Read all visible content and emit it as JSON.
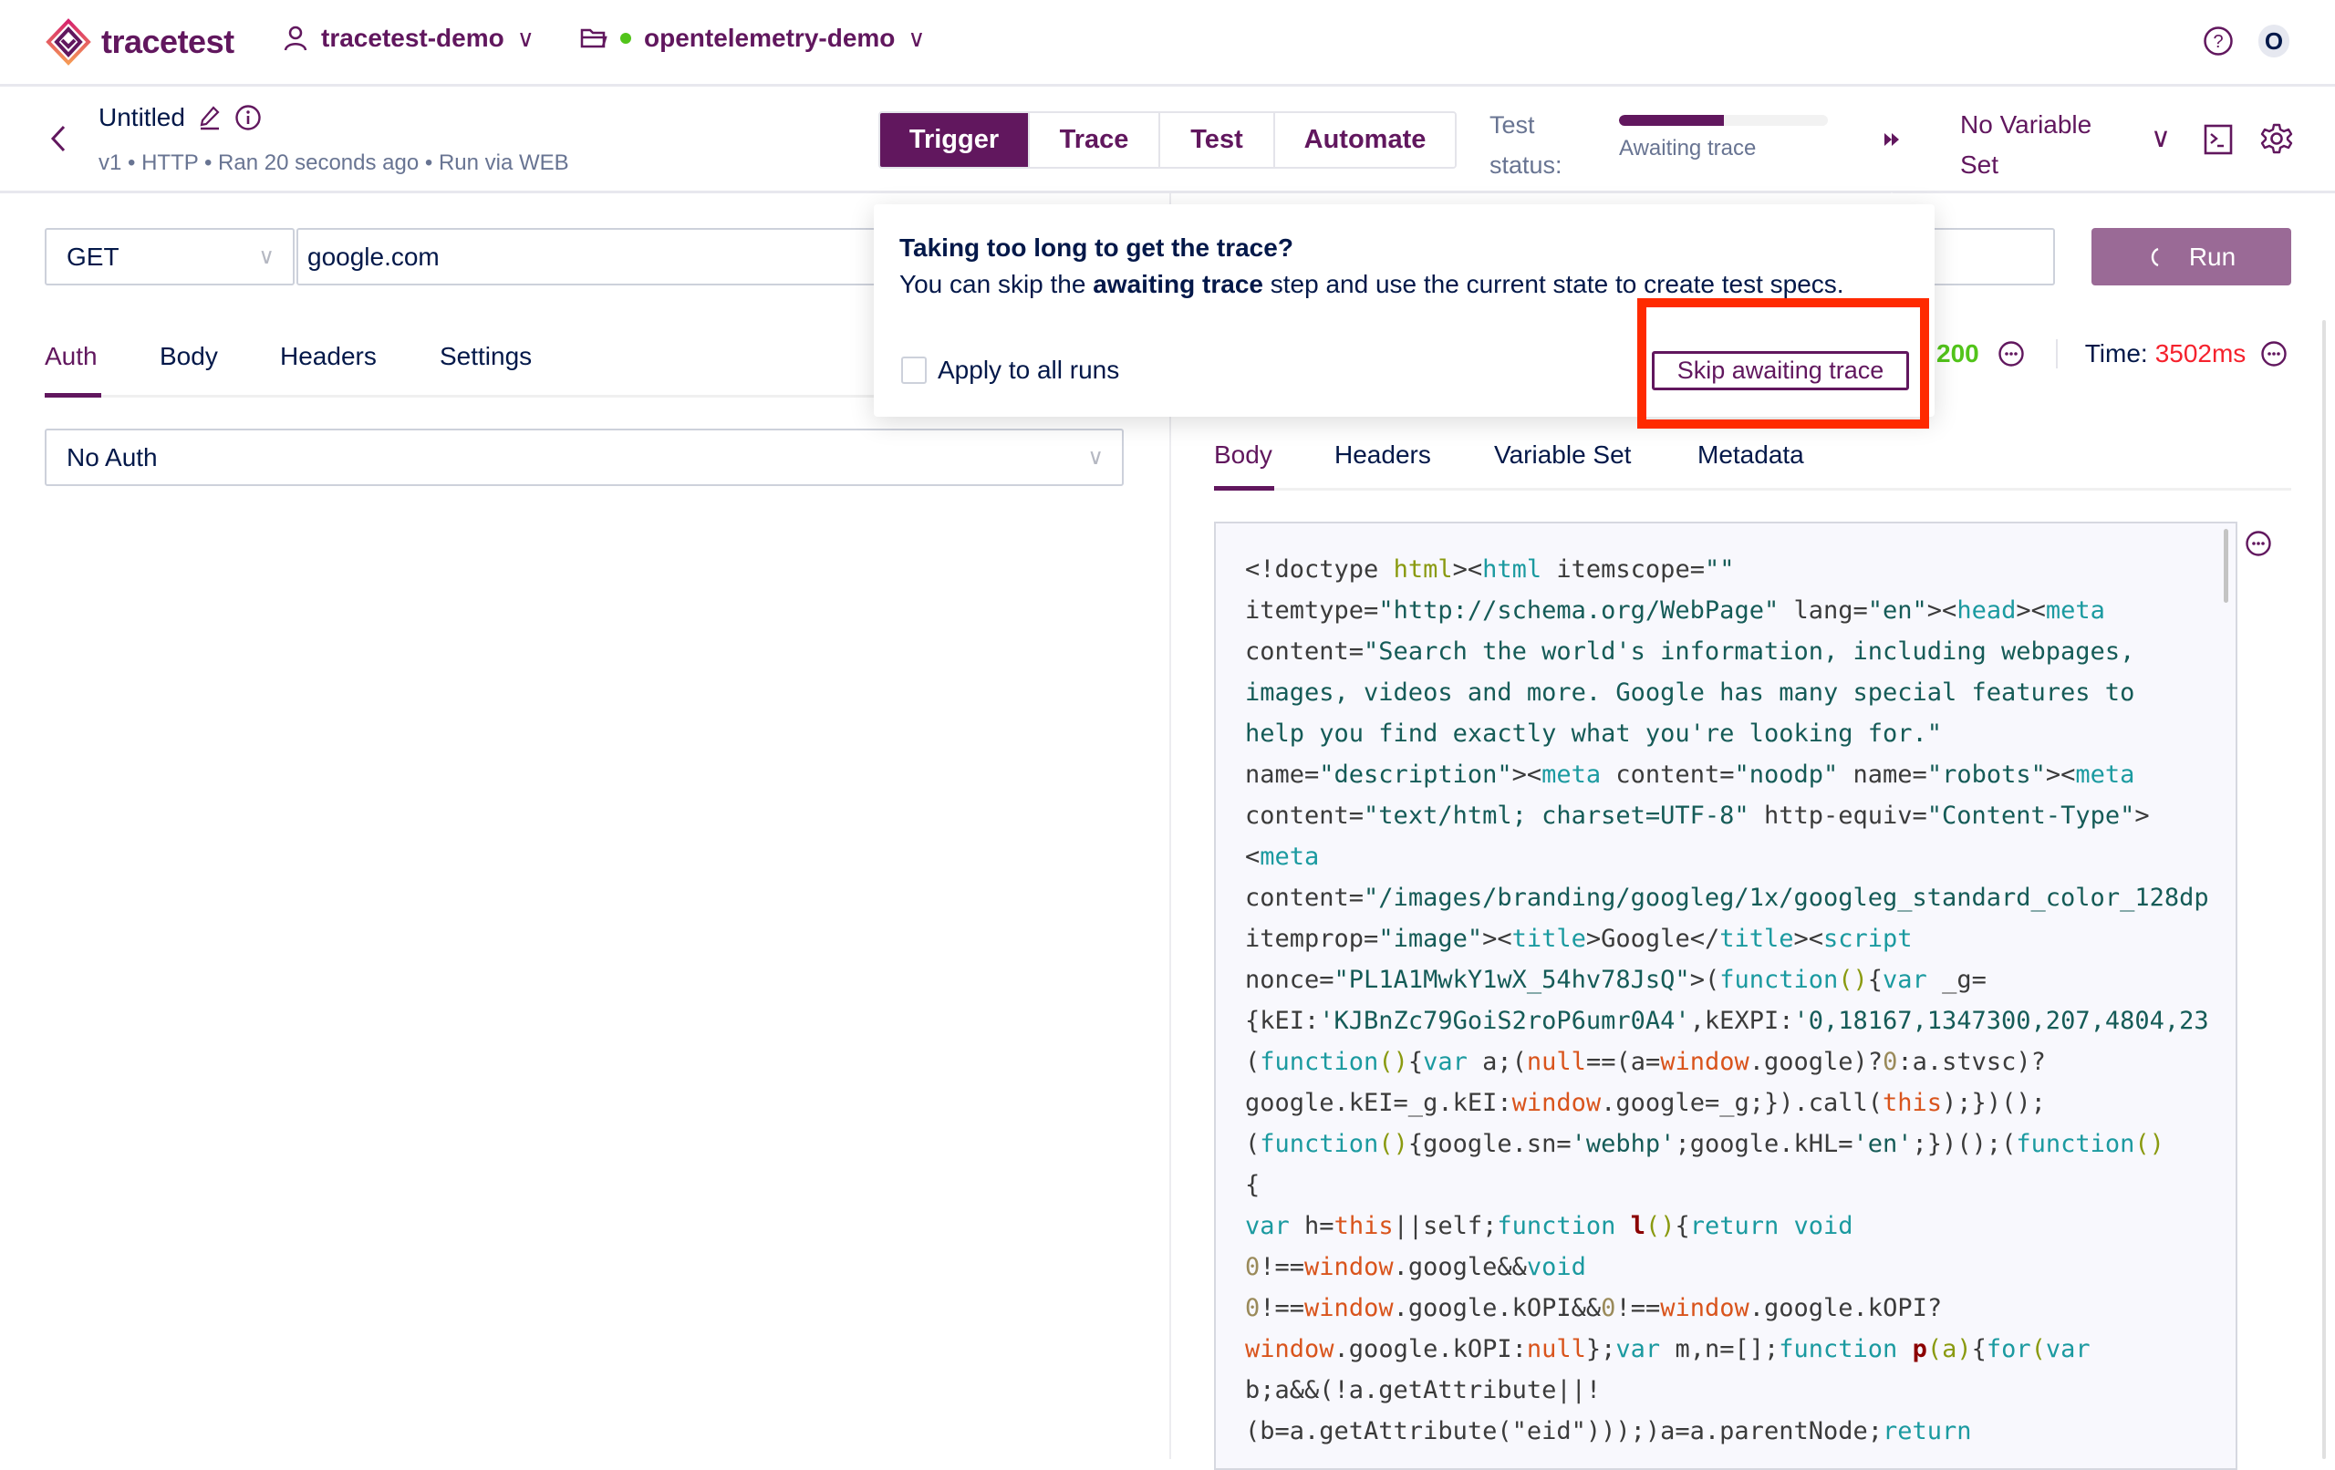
{
  "colors": {
    "primary": "#61175e",
    "success": "#52c41a",
    "error": "#f5222d",
    "highlight": "#ff2a00",
    "run_button": "#9a6a96"
  },
  "topnav": {
    "brand": "tracetest",
    "organization": "tracetest-demo",
    "environment": "opentelemetry-demo",
    "avatar_initial": "O",
    "icons": [
      "user-icon",
      "folder-icon",
      "help-icon"
    ]
  },
  "header": {
    "title": "Untitled",
    "subtitle": "v1 • HTTP • Ran 20 seconds ago • Run via WEB",
    "tabs": [
      {
        "label": "Trigger",
        "active": true
      },
      {
        "label": "Trace"
      },
      {
        "label": "Test"
      },
      {
        "label": "Automate"
      }
    ],
    "status_label_1": "Test",
    "status_label_2": "status:",
    "status_text": "Awaiting trace",
    "progress_percent": 50,
    "variable_set_1": "No Variable",
    "variable_set_2": "Set"
  },
  "request": {
    "method": "GET",
    "url": "google.com",
    "run_label": "Run",
    "tabs": [
      {
        "label": "Auth",
        "active": true
      },
      {
        "label": "Body"
      },
      {
        "label": "Headers"
      },
      {
        "label": "Settings"
      }
    ],
    "auth": "No Auth"
  },
  "response": {
    "status": "200",
    "time_label": "Time:",
    "time_value": "3502ms",
    "tabs": [
      {
        "label": "Body",
        "active": true
      },
      {
        "label": "Headers"
      },
      {
        "label": "Variable Set"
      },
      {
        "label": "Metadata"
      }
    ],
    "code_lines": [
      [
        [
          "<!doctype ",
          ""
        ],
        [
          "html",
          "o"
        ],
        [
          "><",
          ""
        ],
        [
          "html",
          "k"
        ],
        [
          " itemscope=",
          ""
        ],
        [
          "\"\"",
          "s"
        ]
      ],
      [
        [
          "itemtype=",
          ""
        ],
        [
          "\"http://schema.org/WebPage\"",
          "s"
        ],
        [
          " lang=",
          ""
        ],
        [
          "\"en\"",
          "s"
        ],
        [
          "><",
          ""
        ],
        [
          "head",
          "k"
        ],
        [
          "><",
          ""
        ],
        [
          "meta",
          "k"
        ]
      ],
      [
        [
          "content=",
          ""
        ],
        [
          "\"Search the world's information, including webpages,",
          "s"
        ]
      ],
      [
        [
          "images, videos and more. Google has many special features to",
          "s"
        ]
      ],
      [
        [
          "help you find exactly what you're looking for.\"",
          "s"
        ]
      ],
      [
        [
          "name=",
          ""
        ],
        [
          "\"description\"",
          "s"
        ],
        [
          "><",
          ""
        ],
        [
          "meta",
          "k"
        ],
        [
          " content=",
          ""
        ],
        [
          "\"noodp\"",
          "s"
        ],
        [
          " name=",
          ""
        ],
        [
          "\"robots\"",
          "s"
        ],
        [
          "><",
          ""
        ],
        [
          "meta",
          "k"
        ]
      ],
      [
        [
          "content=",
          ""
        ],
        [
          "\"text/html; charset=UTF-8\"",
          "s"
        ],
        [
          " http-equiv=",
          ""
        ],
        [
          "\"Content-Type\"",
          "s"
        ],
        [
          ">",
          ""
        ]
      ],
      [
        [
          "<",
          ""
        ],
        [
          "meta",
          "k"
        ]
      ],
      [
        [
          "content=",
          ""
        ],
        [
          "\"/images/branding/googleg/1x/googleg_standard_color_128dp",
          "s"
        ]
      ],
      [
        [
          "itemprop=",
          ""
        ],
        [
          "\"image\"",
          "s"
        ],
        [
          "><",
          ""
        ],
        [
          "title",
          "k"
        ],
        [
          ">Google</",
          ""
        ],
        [
          "title",
          "k"
        ],
        [
          "><",
          ""
        ],
        [
          "script",
          "k"
        ]
      ],
      [
        [
          "nonce=",
          ""
        ],
        [
          "\"PL1A1MwkY1wX_54hv78JsQ\"",
          "s"
        ],
        [
          ">(",
          ""
        ],
        [
          "function",
          "k"
        ],
        [
          "()",
          "o"
        ],
        [
          "{",
          ""
        ],
        [
          "var",
          "k"
        ],
        [
          " _g=",
          ""
        ]
      ],
      [
        [
          "{kEI:",
          ""
        ],
        [
          "'KJBnZc79GoiS2roP6umr0A4'",
          "s"
        ],
        [
          ",kEXPI:",
          ""
        ],
        [
          "'0,18167,1347300,207,4804,23",
          "s"
        ]
      ],
      [
        [
          "(",
          ""
        ],
        [
          "function",
          "k"
        ],
        [
          "()",
          "o"
        ],
        [
          "{",
          ""
        ],
        [
          "var",
          "k"
        ],
        [
          " a;(",
          ""
        ],
        [
          "null",
          "r"
        ],
        [
          "==(a=",
          ""
        ],
        [
          "window",
          "r"
        ],
        [
          ".google)?",
          ""
        ],
        [
          "0",
          "n"
        ],
        [
          ":a.stvsc)?",
          ""
        ]
      ],
      [
        [
          "google.kEI=_g.kEI:",
          ""
        ],
        [
          "window",
          "r"
        ],
        [
          ".google=_g;}).call(",
          ""
        ],
        [
          "this",
          "r"
        ],
        [
          ");})();",
          ""
        ]
      ],
      [
        [
          "(",
          ""
        ],
        [
          "function",
          "k"
        ],
        [
          "()",
          "o"
        ],
        [
          "{google.sn=",
          ""
        ],
        [
          "'webhp'",
          "s"
        ],
        [
          ";google.kHL=",
          ""
        ],
        [
          "'en'",
          "s"
        ],
        [
          ";})();(",
          ""
        ],
        [
          "function",
          "k"
        ],
        [
          "()",
          "o"
        ]
      ],
      [
        [
          "{",
          ""
        ]
      ],
      [
        [
          "var",
          "k"
        ],
        [
          " h=",
          ""
        ],
        [
          "this",
          "r"
        ],
        [
          "||self;",
          ""
        ],
        [
          "function",
          "k"
        ],
        [
          " ",
          ""
        ],
        [
          "l",
          "f"
        ],
        [
          "()",
          "o"
        ],
        [
          "{",
          ""
        ],
        [
          "return void",
          "k"
        ]
      ],
      [
        [
          "0",
          "n"
        ],
        [
          "!==",
          ""
        ],
        [
          "window",
          "r"
        ],
        [
          ".google&&",
          ""
        ],
        [
          "void",
          "k"
        ]
      ],
      [
        [
          "0",
          "n"
        ],
        [
          "!==",
          ""
        ],
        [
          "window",
          "r"
        ],
        [
          ".google.kOPI&&",
          ""
        ],
        [
          "0",
          "n"
        ],
        [
          "!==",
          ""
        ],
        [
          "window",
          "r"
        ],
        [
          ".google.kOPI?",
          ""
        ]
      ],
      [
        [
          "window",
          "r"
        ],
        [
          ".google.kOPI:",
          ""
        ],
        [
          "null",
          "r"
        ],
        [
          "};",
          ""
        ],
        [
          "var",
          "k"
        ],
        [
          " m,n=[];",
          ""
        ],
        [
          "function",
          "k"
        ],
        [
          " ",
          ""
        ],
        [
          "p",
          "f"
        ],
        [
          "(a)",
          "o"
        ],
        [
          "{",
          ""
        ],
        [
          "for",
          "k"
        ],
        [
          "(",
          "o"
        ],
        [
          "var",
          "k"
        ]
      ],
      [
        [
          "b;a&&(!a.getAttribute||!",
          ""
        ]
      ],
      [
        [
          "(b=a.getAttribute(\"eid\")));)a=a.parentNode;",
          ""
        ],
        [
          "return",
          "k"
        ]
      ]
    ]
  },
  "popup": {
    "title": "Taking too long to get the trace?",
    "body_pre": "You can skip the ",
    "body_bold": "awaiting trace",
    "body_post": " step and use the current state to create test specs.",
    "checkbox_label": "Apply to all runs",
    "checkbox_checked": false,
    "skip_label": "Skip awaiting trace"
  }
}
